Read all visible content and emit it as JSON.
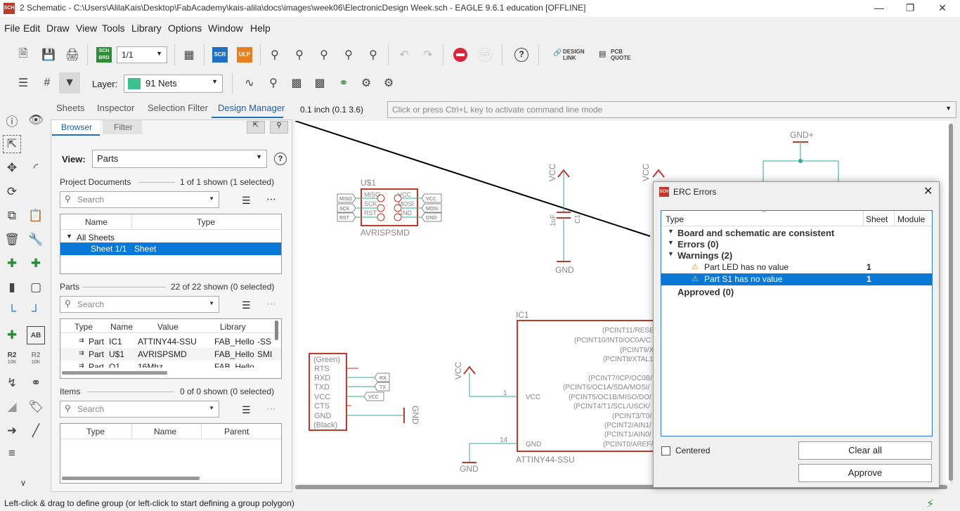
{
  "window": {
    "title": "2 Schematic - C:\\Users\\AlilaKais\\Desktop\\FabAcademy\\kais-alila\\docs\\images\\week06\\ElectronicDesign Week.sch - EAGLE 9.6.1 education [OFFLINE]",
    "app_icon": "SCH"
  },
  "menu": [
    "File",
    "Edit",
    "Draw",
    "View",
    "Tools",
    "Library",
    "Options",
    "Window",
    "Help"
  ],
  "toolbar": {
    "sheet_select": "1/1",
    "scr_label": "SCR",
    "ulp_label": "ULP",
    "brd_label_top": "SCH",
    "brd_label_bottom": "BRD",
    "design_link": "DESIGN\nLINK",
    "design_link_l1": "DESIGN",
    "design_link_l2": "LINK",
    "pcb_quote_l1": "PCB",
    "pcb_quote_l2": "QUOTE"
  },
  "layer": {
    "label": "Layer:",
    "value": "91 Nets",
    "color": "#3dbf8f"
  },
  "left_tools": {
    "r2_label": "R2",
    "r2_sub": "10K",
    "ab_label": "AB"
  },
  "panel": {
    "tabs": [
      "Sheets",
      "Inspector",
      "Selection Filter",
      "Design Manager"
    ],
    "subtabs": [
      "Browser",
      "Filter"
    ],
    "view_label": "View:",
    "view_value": "Parts",
    "project": {
      "title": "Project Documents",
      "info": "1 of 1 shown (1 selected)",
      "search": "Search",
      "col_name": "Name",
      "col_type": "Type",
      "rows": [
        {
          "name": "All Sheets",
          "type": ""
        },
        {
          "name": "Sheet 1/1",
          "type": "Sheet"
        }
      ]
    },
    "parts": {
      "title": "Parts",
      "info": "22 of 22 shown (0 selected)",
      "search": "Search",
      "cols": [
        "Type",
        "Name",
        "Value",
        "Library"
      ],
      "rows": [
        {
          "type": "Part",
          "name": "IC1",
          "value": "ATTINY44-SSU",
          "library": "FAB_Hello",
          "extra": "-SS"
        },
        {
          "type": "Part",
          "name": "U$1",
          "value": "AVRISPSMD",
          "library": "FAB_Hello",
          "extra": "SMI"
        },
        {
          "type": "Part",
          "name": "Q1",
          "value": "16Mhz",
          "library": "FAB_Hello",
          "extra": ""
        }
      ]
    },
    "items": {
      "title": "Items",
      "info": "0 of 0 shown (0 selected)",
      "search": "Search",
      "cols": [
        "Type",
        "Name",
        "Parent"
      ]
    }
  },
  "command": {
    "coords": "0.1 inch (0.1 3.6)",
    "placeholder": "Click or press Ctrl+L key to activate command line mode"
  },
  "schematic": {
    "u1_name": "U$1",
    "u1_value": "AVRISPSMD",
    "u1_pins_left": [
      "MISO",
      "SCK",
      "RST"
    ],
    "u1_pins_right": [
      "VCC",
      "MOSI",
      "GND"
    ],
    "u1_labels_left": [
      "MISO",
      "SCK",
      "RST"
    ],
    "u1_labels_right": [
      "VCC",
      "MOSI",
      "GND"
    ],
    "vcc": "VCC",
    "gnd": "GND",
    "gnd_plus": "GND+",
    "cap_value": "1uF",
    "cap_name": "C1",
    "ic1_name": "IC1",
    "ic1_value": "ATTINY44-SSU",
    "ic1_pin_vcc": "VCC",
    "ic1_pin_gnd": "GND",
    "ic1_pin_vcc_num": "1",
    "ic1_pin_gnd_num": "14",
    "ic1_pins": [
      "(PCINT11/RESE",
      "(PCINT10/INT0/OC0A/C",
      "(PCINT9/X",
      "(PCINT8/XTAL1",
      "(PCINT7/ICP/OC0B/",
      "(PCINT6/OC1A/SDA/MOSI/",
      "(PCINT5/OC1B/MISO/DO/",
      "(PCINT4/T1/SCL/USCK/",
      "(PCINT3/T0/",
      "(PCINT2/AIN1/",
      "(PCINT1/AIN0/",
      "(PCINT0/AREF/"
    ],
    "ftdi_top": "(Green)",
    "ftdi_bottom": "(Black)",
    "ftdi_pins": [
      "RTS",
      "RXD",
      "TXD",
      "VCC",
      "CTS",
      "GND"
    ],
    "ftdi_labels": [
      "RX",
      "TX",
      "VCC"
    ]
  },
  "erc": {
    "title": "ERC Errors",
    "col_type": "Type",
    "col_sheet": "Sheet",
    "col_module": "Module",
    "rows": [
      {
        "text": "Board and schematic are consistent",
        "sheet": ""
      },
      {
        "text": "Errors (0)",
        "sheet": ""
      },
      {
        "text": "Warnings (2)",
        "sheet": ""
      },
      {
        "text": "Part LED has no value",
        "sheet": "1"
      },
      {
        "text": "Part S1 has no value",
        "sheet": "1"
      },
      {
        "text": "Approved (0)",
        "sheet": ""
      }
    ],
    "centered_label": "Centered",
    "clear_all": "Clear all",
    "approve": "Approve",
    "selection_color": "#0a78d7"
  },
  "status": {
    "text": "Left-click & drag to define group (or left-click to start defining a group polygon)"
  }
}
